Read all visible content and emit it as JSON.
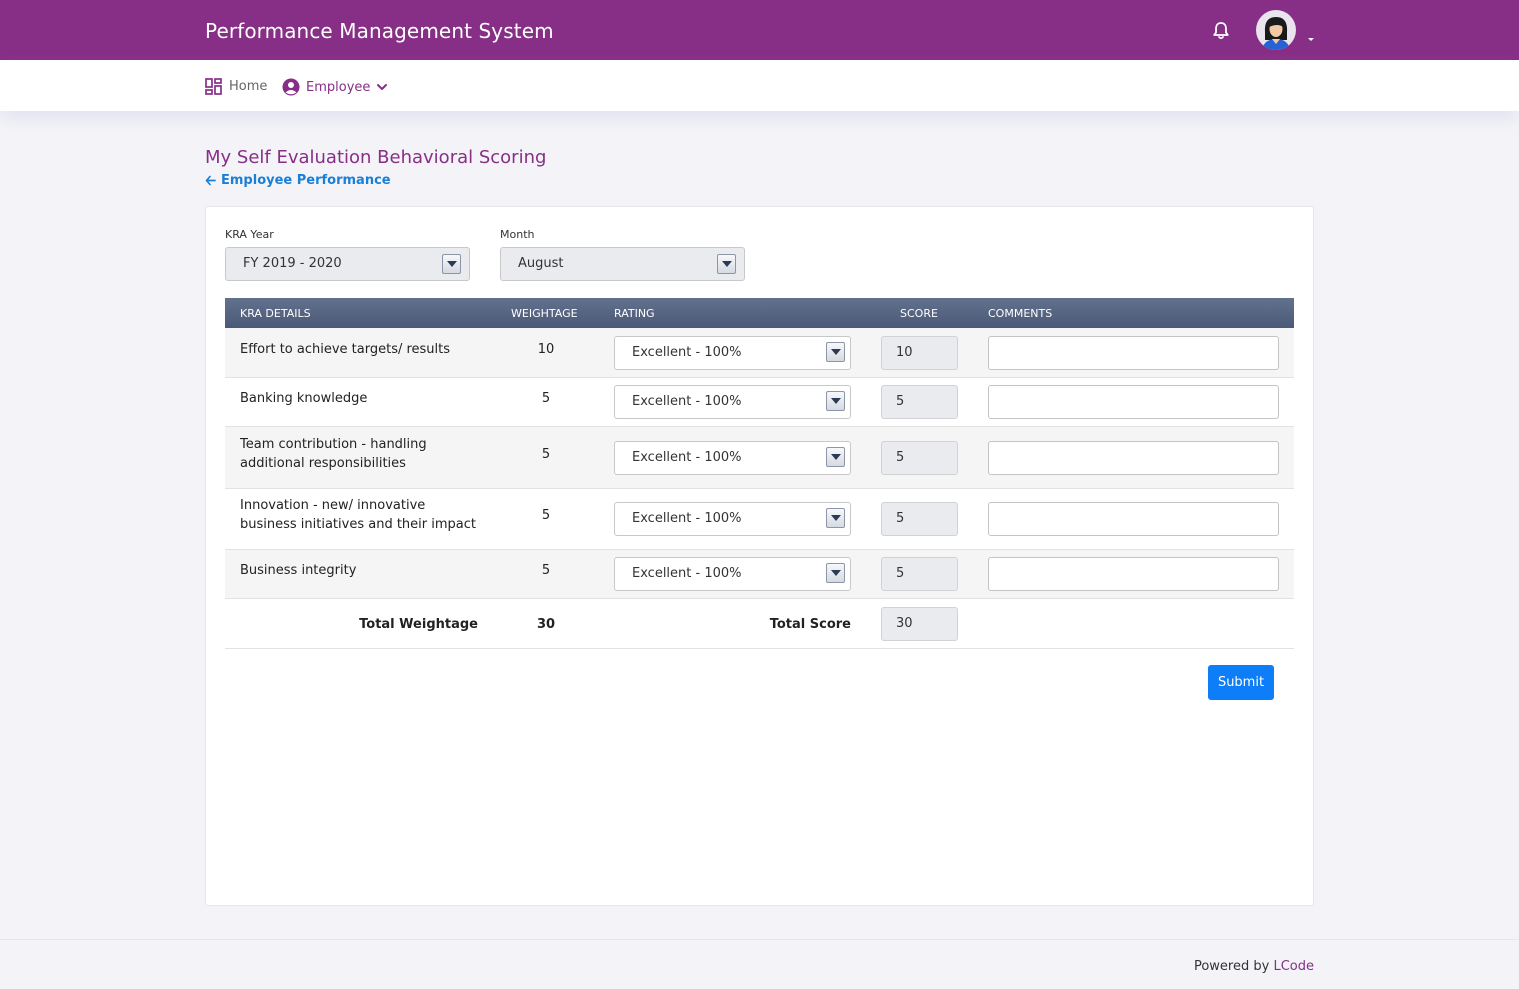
{
  "app": {
    "title": "Performance Management System"
  },
  "nav": {
    "home_label": "Home",
    "employee_label": "Employee"
  },
  "page": {
    "title": "My Self Evaluation Behavioral Scoring",
    "back_link": "Employee Performance"
  },
  "filters": {
    "kra_year_label": "KRA Year",
    "kra_year_value": "FY 2019 - 2020",
    "month_label": "Month",
    "month_value": "August"
  },
  "table": {
    "headers": [
      "KRA DETAILS",
      "WEIGHTAGE",
      "RATING",
      "SCORE",
      "COMMENTS"
    ],
    "rows": [
      {
        "kra_lines": [
          "Effort to achieve targets/ results"
        ],
        "weightage": "10",
        "rating": "Excellent - 100%",
        "score": "10",
        "comment": ""
      },
      {
        "kra_lines": [
          "Banking knowledge"
        ],
        "weightage": "5",
        "rating": "Excellent - 100%",
        "score": "5",
        "comment": ""
      },
      {
        "kra_lines": [
          "Team contribution - handling",
          "additional responsibilities"
        ],
        "weightage": "5",
        "rating": "Excellent - 100%",
        "score": "5",
        "comment": ""
      },
      {
        "kra_lines": [
          "Innovation - new/ innovative",
          "business initiatives and their impact"
        ],
        "weightage": "5",
        "rating": "Excellent - 100%",
        "score": "5",
        "comment": ""
      },
      {
        "kra_lines": [
          "Business integrity"
        ],
        "weightage": "5",
        "rating": "Excellent - 100%",
        "score": "5",
        "comment": ""
      }
    ],
    "total_weightage_label": "Total Weightage",
    "total_weightage": "30",
    "total_score_label": "Total Score",
    "total_score": "30"
  },
  "actions": {
    "submit_label": "Submit"
  },
  "footer": {
    "prefix": "Powered by",
    "brand": "LCode"
  },
  "colors": {
    "brand": "#872f86",
    "primary": "#0d7ef7",
    "link": "#1a7fd6",
    "table_header": "#56647f"
  },
  "icons": [
    "bell-icon",
    "avatar",
    "dashboard-icon",
    "user-circle-icon",
    "chevron-down-icon",
    "arrow-left-icon",
    "dropdown-arrow-icon"
  ]
}
